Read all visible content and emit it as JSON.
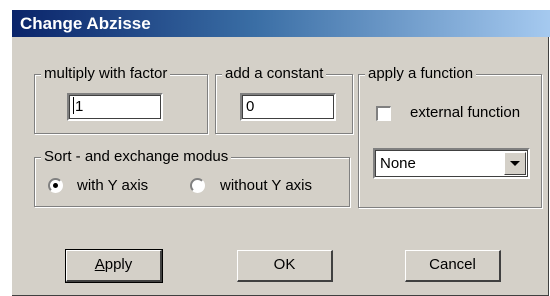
{
  "window": {
    "title": "Change Abzisse"
  },
  "multiply": {
    "legend": "multiply with factor",
    "value": "1"
  },
  "constant": {
    "legend": "add a constant",
    "value": "0"
  },
  "function": {
    "legend": "apply a function",
    "external_label": "external function",
    "external_checked": false,
    "selected": "None"
  },
  "sort": {
    "legend": "Sort - and exchange modus",
    "option_with": "with Y axis",
    "option_without": "without Y axis",
    "selected": "with Y axis"
  },
  "buttons": {
    "apply_mnemonic": "A",
    "apply_rest": "pply",
    "ok": "OK",
    "cancel": "Cancel"
  }
}
